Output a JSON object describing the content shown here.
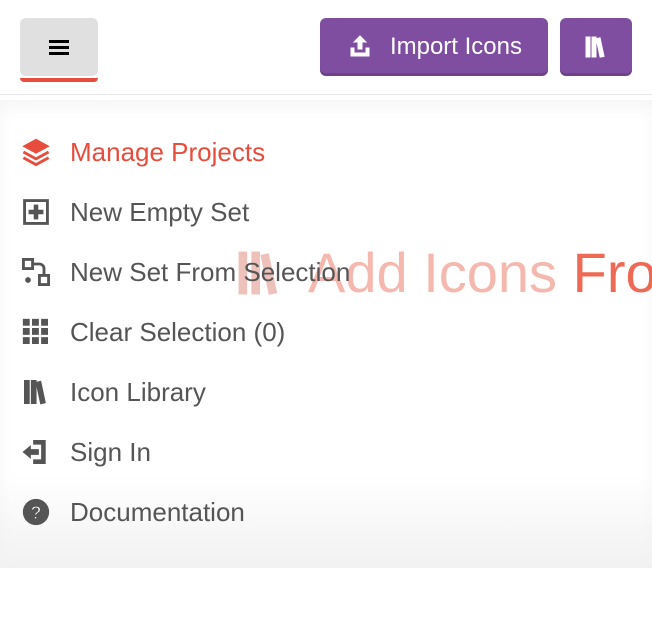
{
  "toolbar": {
    "hamburger_icon": "menu",
    "import_label": "Import Icons",
    "import_icon": "upload",
    "library_icon": "books"
  },
  "watermark": {
    "text_pre": "Add Icons ",
    "text_em": "From L"
  },
  "menu": {
    "items": [
      {
        "icon": "layers",
        "label": "Manage Projects",
        "active": true
      },
      {
        "icon": "plus-box",
        "label": "New Empty Set",
        "active": false
      },
      {
        "icon": "flow",
        "label": "New Set From Selection",
        "active": false
      },
      {
        "icon": "grid",
        "label": "Clear Selection (0)",
        "active": false
      },
      {
        "icon": "books",
        "label": "Icon Library",
        "active": false
      },
      {
        "icon": "signin",
        "label": "Sign In",
        "active": false
      },
      {
        "icon": "help",
        "label": "Documentation",
        "active": false
      }
    ]
  }
}
